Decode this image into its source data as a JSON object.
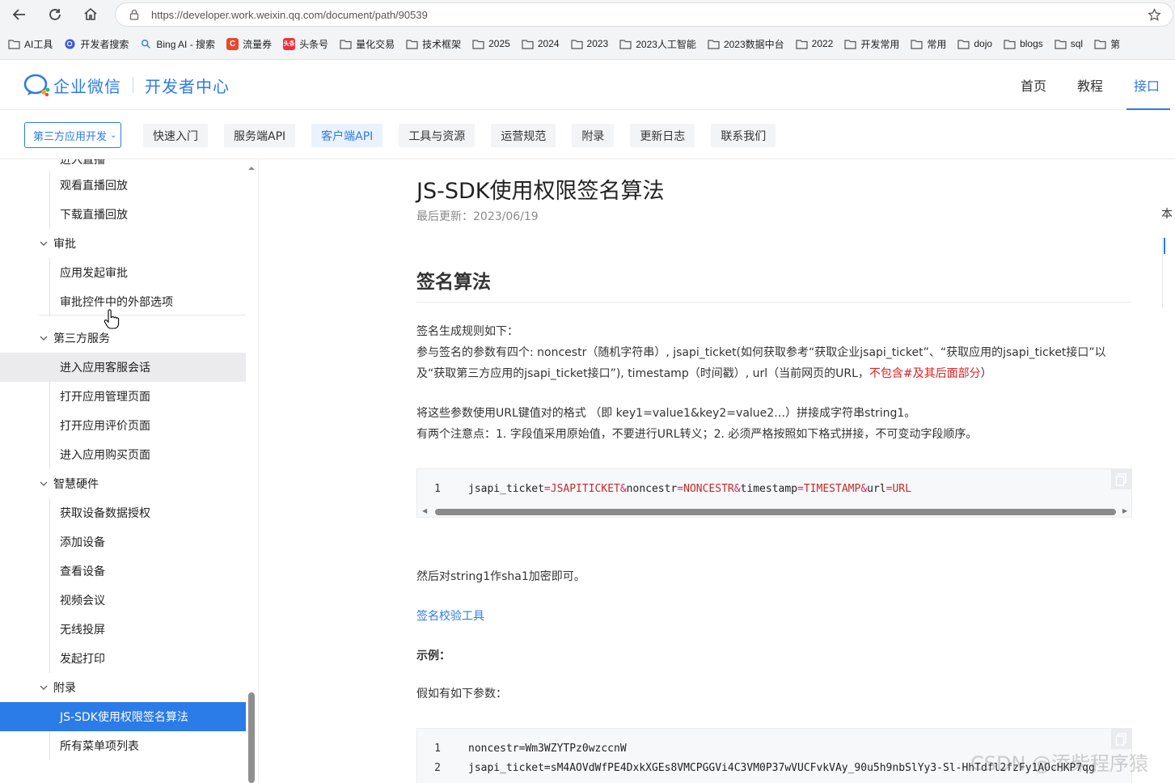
{
  "browser": {
    "url": "https://developer.work.weixin.qq.com/document/path/90539",
    "bookmarks": [
      {
        "label": "AI工具",
        "icon": "folder-icon"
      },
      {
        "label": "开发者搜索",
        "icon": "search-badge-icon"
      },
      {
        "label": "Bing AI - 搜索",
        "icon": "search-icon"
      },
      {
        "label": "流量券",
        "icon": "c-badge-icon"
      },
      {
        "label": "头条号",
        "icon": "toutiao-icon"
      },
      {
        "label": "量化交易",
        "icon": "folder-icon"
      },
      {
        "label": "技术框架",
        "icon": "folder-icon"
      },
      {
        "label": "2025",
        "icon": "folder-icon"
      },
      {
        "label": "2024",
        "icon": "folder-icon"
      },
      {
        "label": "2023",
        "icon": "folder-icon"
      },
      {
        "label": "2023人工智能",
        "icon": "folder-icon"
      },
      {
        "label": "2023数据中台",
        "icon": "folder-icon"
      },
      {
        "label": "2022",
        "icon": "folder-icon"
      },
      {
        "label": "开发常用",
        "icon": "folder-icon"
      },
      {
        "label": "常用",
        "icon": "folder-icon"
      },
      {
        "label": "dojo",
        "icon": "folder-icon"
      },
      {
        "label": "blogs",
        "icon": "folder-icon"
      },
      {
        "label": "sql",
        "icon": "folder-icon"
      },
      {
        "label": "第",
        "icon": "folder-icon"
      }
    ]
  },
  "header": {
    "brand": "企业微信",
    "subtitle": "开发者中心",
    "nav": [
      "首页",
      "教程",
      "接口"
    ],
    "active_nav": "接口"
  },
  "subnav": {
    "dropdown": "第三方应用开发",
    "tabs": [
      "快速入门",
      "服务端API",
      "客户端API",
      "工具与资源",
      "运营规范",
      "附录",
      "更新日志",
      "联系我们"
    ],
    "active_tab": "客户端API"
  },
  "sidebar": {
    "partial_top": "进入直播",
    "items": [
      {
        "type": "leaf",
        "label": "观看直播回放"
      },
      {
        "type": "leaf",
        "label": "下载直播回放"
      },
      {
        "type": "group",
        "label": "审批"
      },
      {
        "type": "leaf",
        "label": "应用发起审批"
      },
      {
        "type": "leaf",
        "label": "审批控件中的外部选项"
      },
      {
        "type": "group",
        "label": "第三方服务"
      },
      {
        "type": "leaf",
        "label": "进入应用客服会话",
        "state": "hover"
      },
      {
        "type": "leaf",
        "label": "打开应用管理页面"
      },
      {
        "type": "leaf",
        "label": "打开应用评价页面"
      },
      {
        "type": "leaf",
        "label": "进入应用购买页面"
      },
      {
        "type": "group",
        "label": "智慧硬件"
      },
      {
        "type": "leaf",
        "label": "获取设备数据授权"
      },
      {
        "type": "leaf",
        "label": "添加设备"
      },
      {
        "type": "leaf",
        "label": "查看设备"
      },
      {
        "type": "leaf",
        "label": "视频会议"
      },
      {
        "type": "leaf",
        "label": "无线投屏"
      },
      {
        "type": "leaf",
        "label": "发起打印"
      },
      {
        "type": "group",
        "label": "附录"
      },
      {
        "type": "leaf",
        "label": "JS-SDK使用权限签名算法",
        "state": "selected"
      },
      {
        "type": "leaf",
        "label": "所有菜单项列表"
      }
    ]
  },
  "doc": {
    "title": "JS-SDK使用权限签名算法",
    "updated": "最后更新：2023/06/19",
    "section": "签名算法",
    "p1_line1": "签名生成规则如下：",
    "p1_line2": "参与签名的参数有四个: noncestr（随机字符串）, jsapi_ticket(如何获取参考“获取企业jsapi_ticket”、“获取应用的jsapi_ticket接口”以",
    "p1_line3_a": "及“获取第三方应用的jsapi_ticket接口”), timestamp（时间戳）, url（当前网页的URL，",
    "p1_line3_red": "不包含#及其后面部分",
    "p1_line3_b": "）",
    "p2_line1": "将这些参数使用URL键值对的格式 （即 key1=value1&key2=value2…）拼接成字符串string1。",
    "p2_line2": "有两个注意点：1. 字段值采用原始值，不要进行URL转义；2. 必须严格按照如下格式拼接，不可变动字段顺序。",
    "code1": {
      "line_no": "1",
      "tokens": [
        {
          "t": "jsapi_ticket",
          "c": "k"
        },
        {
          "t": "=",
          "c": "op"
        },
        {
          "t": "JSAPITICKET",
          "c": "v"
        },
        {
          "t": "&",
          "c": "op"
        },
        {
          "t": "noncestr",
          "c": "k"
        },
        {
          "t": "=",
          "c": "op"
        },
        {
          "t": "NONCESTR",
          "c": "v"
        },
        {
          "t": "&",
          "c": "op"
        },
        {
          "t": "timestamp",
          "c": "k"
        },
        {
          "t": "=",
          "c": "op"
        },
        {
          "t": "TIMESTAMP",
          "c": "v"
        },
        {
          "t": "&",
          "c": "op"
        },
        {
          "t": "url",
          "c": "k"
        },
        {
          "t": "=",
          "c": "op"
        },
        {
          "t": "URL",
          "c": "v"
        }
      ]
    },
    "p3": "然后对string1作sha1加密即可。",
    "tool_link": "签名校验工具",
    "example_label": "示例：",
    "p4": "假如有如下参数：",
    "code2": [
      {
        "line_no": "1",
        "text": "noncestr=Wm3WZYTPz0wzccnW"
      },
      {
        "line_no": "2",
        "text": "jsapi_ticket=sM4AOVdWfPE4DxkXGEs8VMCPGGVi4C3VM0P37wVUCFvkVAy_90u5h9nbSlYy3-Sl-HhTdfl2fzFy1AOcHKP7qg"
      }
    ]
  },
  "right_panel": {
    "label": "本"
  },
  "watermark": "CSDN @添柴程序猿",
  "colors": {
    "accent": "#2b7be9",
    "highlight_red": "#e02020"
  }
}
